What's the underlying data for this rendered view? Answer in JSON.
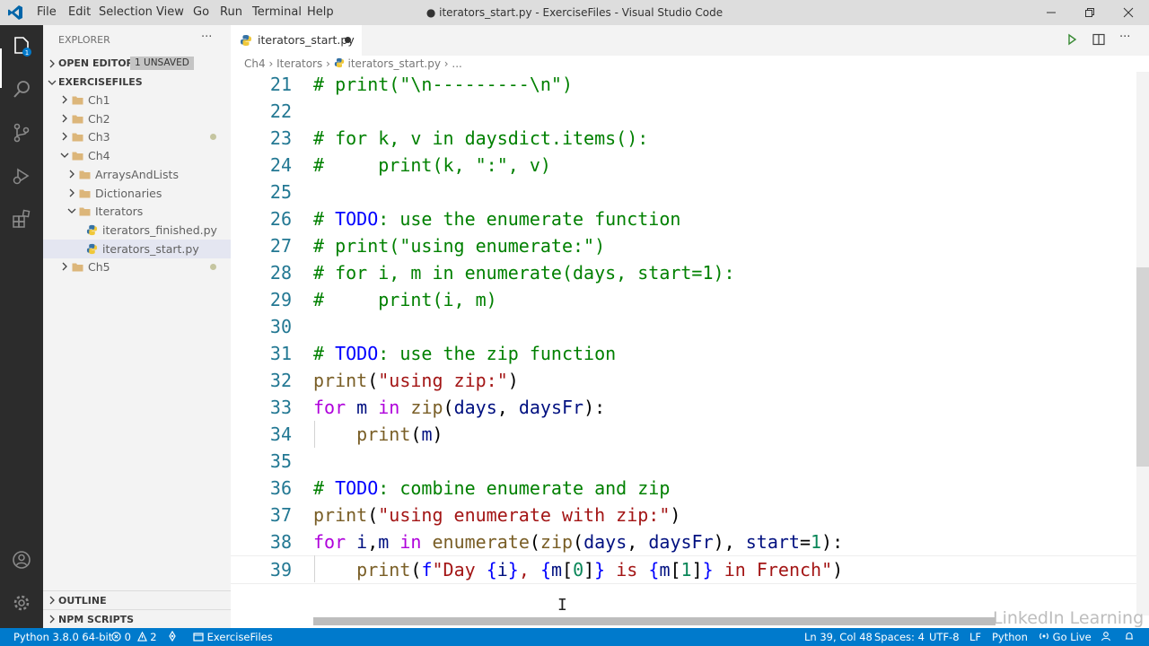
{
  "titlebar": {
    "menus": [
      "File",
      "Edit",
      "Selection",
      "View",
      "Go",
      "Run",
      "Terminal",
      "Help"
    ],
    "title": "● iterators_start.py - ExerciseFiles - Visual Studio Code"
  },
  "sidebar": {
    "header": "EXPLORER",
    "more": "···",
    "open_editors": "OPEN EDITORS",
    "unsaved_badge": "1 UNSAVED",
    "root": "EXERCISEFILES",
    "tree": [
      {
        "label": "Ch1",
        "type": "folder",
        "depth": 0,
        "expanded": false,
        "modified": false
      },
      {
        "label": "Ch2",
        "type": "folder",
        "depth": 0,
        "expanded": false,
        "modified": false
      },
      {
        "label": "Ch3",
        "type": "folder",
        "depth": 0,
        "expanded": false,
        "modified": true
      },
      {
        "label": "Ch4",
        "type": "folder",
        "depth": 0,
        "expanded": true,
        "modified": false
      },
      {
        "label": "ArraysAndLists",
        "type": "folder",
        "depth": 1,
        "expanded": false,
        "modified": false
      },
      {
        "label": "Dictionaries",
        "type": "folder",
        "depth": 1,
        "expanded": false,
        "modified": false
      },
      {
        "label": "Iterators",
        "type": "folder",
        "depth": 1,
        "expanded": true,
        "modified": false
      },
      {
        "label": "iterators_finished.py",
        "type": "file",
        "depth": 2,
        "modified": false
      },
      {
        "label": "iterators_start.py",
        "type": "file",
        "depth": 2,
        "modified": false,
        "selected": true
      },
      {
        "label": "Ch5",
        "type": "folder",
        "depth": 0,
        "expanded": false,
        "modified": true
      }
    ],
    "outline": "OUTLINE",
    "npm_scripts": "NPM SCRIPTS"
  },
  "editor": {
    "tab_label": "iterators_start.py",
    "breadcrumb": {
      "seg1": "Ch4",
      "seg2": "Iterators",
      "seg3": "iterators_start.py",
      "seg4": "..."
    },
    "lines": [
      {
        "n": "21",
        "t": [
          [
            "c",
            "# print(\"\\n---------\\n\")"
          ]
        ]
      },
      {
        "n": "22",
        "t": []
      },
      {
        "n": "23",
        "t": [
          [
            "c",
            "# for k, v in daysdict.items():"
          ]
        ]
      },
      {
        "n": "24",
        "t": [
          [
            "c",
            "#     print(k, \":\", v)"
          ]
        ]
      },
      {
        "n": "25",
        "t": []
      },
      {
        "n": "26",
        "t": [
          [
            "c",
            "# "
          ],
          [
            "b",
            "TODO"
          ],
          [
            "c",
            ": use the enumerate function"
          ]
        ]
      },
      {
        "n": "27",
        "t": [
          [
            "c",
            "# print(\"using enumerate:\")"
          ]
        ]
      },
      {
        "n": "28",
        "t": [
          [
            "c",
            "# for i, m in enumerate(days, start=1):"
          ]
        ]
      },
      {
        "n": "29",
        "t": [
          [
            "c",
            "#     print(i, m)"
          ]
        ]
      },
      {
        "n": "30",
        "t": []
      },
      {
        "n": "31",
        "t": [
          [
            "c",
            "# "
          ],
          [
            "b",
            "TODO"
          ],
          [
            "c",
            ": use the zip function"
          ]
        ]
      },
      {
        "n": "32",
        "t": [
          [
            "f",
            "print"
          ],
          [
            "p",
            "("
          ],
          [
            "s",
            "\"using zip:\""
          ],
          [
            "p",
            ")"
          ]
        ]
      },
      {
        "n": "33",
        "t": [
          [
            "k",
            "for"
          ],
          [
            "p",
            " "
          ],
          [
            "v",
            "m"
          ],
          [
            "p",
            " "
          ],
          [
            "k",
            "in"
          ],
          [
            "p",
            " "
          ],
          [
            "f",
            "zip"
          ],
          [
            "p",
            "("
          ],
          [
            "v",
            "days"
          ],
          [
            "p",
            ", "
          ],
          [
            "v",
            "daysFr"
          ],
          [
            "p",
            "):"
          ]
        ]
      },
      {
        "n": "34",
        "t": [
          [
            "p",
            "    "
          ],
          [
            "f",
            "print"
          ],
          [
            "p",
            "("
          ],
          [
            "v",
            "m"
          ],
          [
            "p",
            ")"
          ]
        ]
      },
      {
        "n": "35",
        "t": []
      },
      {
        "n": "36",
        "t": [
          [
            "c",
            "# "
          ],
          [
            "b",
            "TODO"
          ],
          [
            "c",
            ": combine enumerate and zip"
          ]
        ]
      },
      {
        "n": "37",
        "t": [
          [
            "f",
            "print"
          ],
          [
            "p",
            "("
          ],
          [
            "s",
            "\"using enumerate with zip:\""
          ],
          [
            "p",
            ")"
          ]
        ]
      },
      {
        "n": "38",
        "t": [
          [
            "k",
            "for"
          ],
          [
            "p",
            " "
          ],
          [
            "v",
            "i"
          ],
          [
            "p",
            ","
          ],
          [
            "v",
            "m"
          ],
          [
            "p",
            " "
          ],
          [
            "k",
            "in"
          ],
          [
            "p",
            " "
          ],
          [
            "f",
            "enumerate"
          ],
          [
            "p",
            "("
          ],
          [
            "f",
            "zip"
          ],
          [
            "p",
            "("
          ],
          [
            "v",
            "days"
          ],
          [
            "p",
            ", "
          ],
          [
            "v",
            "daysFr"
          ],
          [
            "p",
            "), "
          ],
          [
            "v",
            "start"
          ],
          [
            "p",
            "="
          ],
          [
            "n",
            "1"
          ],
          [
            "p",
            "):"
          ]
        ]
      },
      {
        "n": "39",
        "t": [
          [
            "p",
            "    "
          ],
          [
            "f",
            "print"
          ],
          [
            "p",
            "("
          ],
          [
            "b",
            "f"
          ],
          [
            "s",
            "\"Day "
          ],
          [
            "b",
            "{"
          ],
          [
            "v",
            "i"
          ],
          [
            "b",
            "}"
          ],
          [
            "s",
            ", "
          ],
          [
            "b",
            "{"
          ],
          [
            "v",
            "m"
          ],
          [
            "p",
            "["
          ],
          [
            "n",
            "0"
          ],
          [
            "p",
            "]"
          ],
          [
            "b",
            "}"
          ],
          [
            "s",
            " is "
          ],
          [
            "b",
            "{"
          ],
          [
            "v",
            "m"
          ],
          [
            "p",
            "["
          ],
          [
            "n",
            "1"
          ],
          [
            "p",
            "]"
          ],
          [
            "b",
            "}"
          ],
          [
            "s",
            " in French\""
          ],
          [
            "p",
            ")"
          ]
        ]
      }
    ]
  },
  "statusbar": {
    "python": "Python 3.8.0 64-bit",
    "errors": "0",
    "warnings": "2",
    "folder": "ExerciseFiles",
    "position": "Ln 39, Col 48",
    "spaces": "Spaces: 4",
    "encoding": "UTF-8",
    "eol": "LF",
    "language": "Python",
    "golive": "Go Live"
  },
  "watermark": "LinkedIn Learning",
  "colors": {
    "statusbar": "#007acc",
    "activitybar": "#2c2c2c",
    "comment": "#008000",
    "string": "#a31515",
    "keyword": "#af00db"
  }
}
